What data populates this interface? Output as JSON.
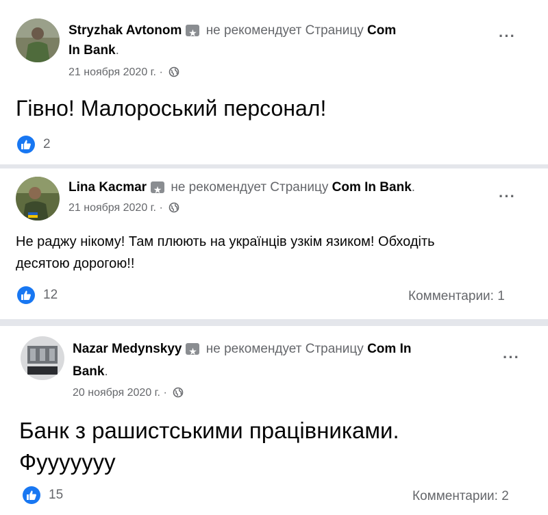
{
  "posts": [
    {
      "author": "Stryzhak Avtonom",
      "action": "не рекомендует Страницу",
      "page_name_line1": "Com",
      "page_name_line2": "In Bank",
      "page_name_suffix": ".",
      "date": "21 ноября 2020 г. ·",
      "text": "Гівно! Малороський персонал!",
      "likes": "2",
      "more": "···"
    },
    {
      "author": "Lina Kacmar",
      "action": "не рекомендует Страницу",
      "page_name": "Com In Bank",
      "page_name_suffix": ".",
      "date": "21 ноября 2020 г. ·",
      "text_line1": "Не раджу нікому! Там плюють на українців узкім язиком! Обходіть",
      "text_line2": "десятою дорогою!!",
      "likes": "12",
      "comments": "Комментарии: 1",
      "more": "···"
    },
    {
      "author": "Nazar Medynskyy",
      "action": "не рекомендует Страницу",
      "page_name_line1": "Com In",
      "page_name_line2": "Bank",
      "page_name_suffix": ".",
      "date": "20 ноября 2020 г. ·",
      "text_line1": "Банк з рашистськими працівниками.",
      "text_line2": "Фууууууу",
      "likes": "15",
      "comments": "Комментарии: 2",
      "more": "···"
    }
  ],
  "icons": {
    "verified_badge": "star-badge-icon",
    "privacy": "globe-icon",
    "reaction": "thumbs-up-icon",
    "menu": "more-horizontal-icon"
  },
  "colors": {
    "text": "#050505",
    "secondary": "#65676b",
    "like_blue": "#1877f2",
    "separator": "#e4e6eb"
  }
}
